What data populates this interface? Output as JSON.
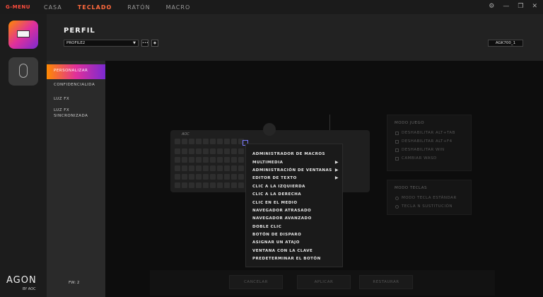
{
  "app": {
    "logo": "G-MENU"
  },
  "nav": [
    "CASA",
    "TECLADO",
    "RATÓN",
    "MACRO"
  ],
  "window": {
    "settings": "⚙",
    "minimize": "—",
    "restore": "❐",
    "close": "✕"
  },
  "brand": {
    "agon": "AGON",
    "by_aoc": "BY AOC"
  },
  "header": {
    "title": "PERFIL",
    "profile_value": "PROFILE2",
    "model_value": "AGK700_1"
  },
  "sidebar": {
    "items": [
      "PERSONALIZAR",
      "CONFIDENCIALIDA",
      "LUZ FX",
      "LUZ FX SINCRONIZADA"
    ],
    "fw": "FW: 2"
  },
  "keyboard": {
    "logo": "AOC"
  },
  "modo_juego": {
    "title": "MODO JUEGO",
    "options": [
      "DESHABILITAR ALT+TAB",
      "DESHABILITAR ALT+F4",
      "DESHABILITAR WIN",
      "CAMBIAR WASD"
    ]
  },
  "modo_teclas": {
    "title": "MODO TECLAS",
    "options": [
      "MODO TECLA ESTÁNDAR",
      "TECLA N SUSTITUCIÓN"
    ]
  },
  "footer": {
    "cancel": "CANCELAR",
    "apply": "APLICAR",
    "restore": "RESTAURAR"
  },
  "context_menu": {
    "items": [
      {
        "label": "ADMINISTRADOR DE MACROS",
        "submenu": false
      },
      {
        "label": "MULTIMEDIA",
        "submenu": true
      },
      {
        "label": "ADMINISTRACIÓN DE VENTANAS",
        "submenu": true
      },
      {
        "label": "EDITOR DE TEXTO",
        "submenu": true
      },
      {
        "label": "CLIC A LA IZQUIERDA",
        "submenu": false
      },
      {
        "label": "CLIC A LA DERECHA",
        "submenu": false
      },
      {
        "label": "CLIC EN EL MEDIO",
        "submenu": false
      },
      {
        "label": "NAVEGADOR ATRASADO",
        "submenu": false
      },
      {
        "label": "NAVEGADOR AVANZADO",
        "submenu": false
      },
      {
        "label": "DOBLE CLIC",
        "submenu": false
      },
      {
        "label": "BOTÓN DE DISPARO",
        "submenu": false
      },
      {
        "label": "ASIGNAR UN ATAJO",
        "submenu": false
      },
      {
        "label": "VENTANA CON LA CLAVE",
        "submenu": false
      },
      {
        "label": "PREDETERMINAR EL BOTÓN",
        "submenu": false
      }
    ],
    "submenu_glyph": "▶"
  },
  "colors": {
    "accent": "#ff6a3d",
    "logo": "#ff4d3d",
    "gradient_start": "#ff8a00",
    "gradient_mid": "#e0309b",
    "gradient_end": "#7b2ad1"
  }
}
